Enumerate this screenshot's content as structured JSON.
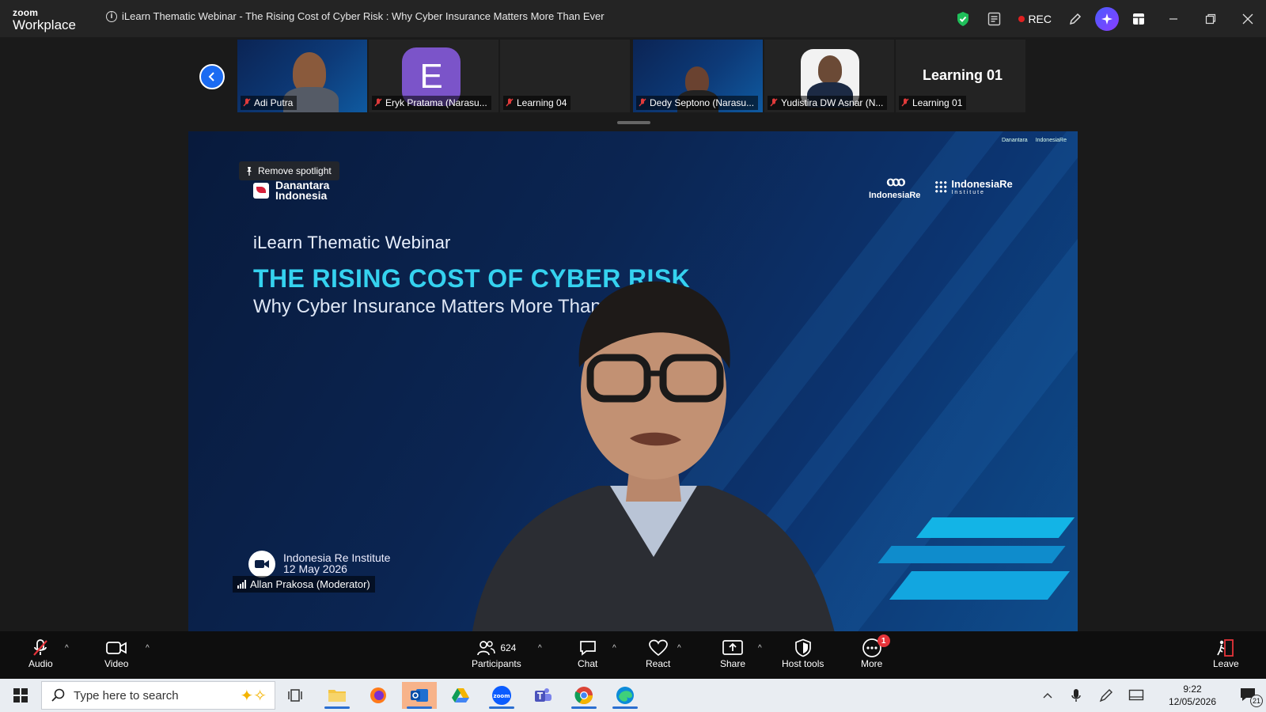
{
  "app": {
    "brand_top": "zoom",
    "brand_bottom": "Workplace"
  },
  "meeting": {
    "title": "iLearn Thematic Webinar - The Rising Cost of Cyber Risk : Why Cyber Insurance Matters More Than Ever"
  },
  "titlebar": {
    "rec_label": "REC"
  },
  "filmstrip": {
    "tiles": [
      {
        "name": "Adi Putra"
      },
      {
        "name": "Eryk Pratama (Narasu...",
        "initial": "E"
      },
      {
        "name": "Learning 04"
      },
      {
        "name": "Dedy Septono (Narasu..."
      },
      {
        "name": "Yudistira DW Asnar (N..."
      },
      {
        "name": "Learning 01"
      }
    ],
    "active_speaker_label": "Learning 01"
  },
  "stage": {
    "spotlight_label": "Remove spotlight",
    "slide": {
      "org_logo_line1": "Danantara",
      "org_logo_line2": "Indonesia",
      "kicker": "iLearn Thematic Webinar",
      "title": "THE RISING COST OF CYBER RISK",
      "subtitle": "Why Cyber Insurance Matters More Than Ever",
      "partner_1": "IndonesiaRe",
      "partner_2": "IndonesiaRe",
      "partner_2_sub": "Institute",
      "footer_org": "Indonesia Re Institute",
      "footer_date": "12 May 2026"
    },
    "speaker_name": "Allan Prakosa (Moderator)"
  },
  "toolbar": {
    "audio": "Audio",
    "video": "Video",
    "participants": "Participants",
    "participants_count": "624",
    "chat": "Chat",
    "react": "React",
    "share": "Share",
    "host_tools": "Host tools",
    "more": "More",
    "more_badge": "1",
    "leave": "Leave"
  },
  "taskbar": {
    "search_placeholder": "Type here to search",
    "time": "9:22",
    "date": "12/05/2026",
    "notification_count": "21"
  },
  "colors": {
    "accent_blue": "#1b6bf2",
    "slide_title": "#35d2ef",
    "rec_red": "#e02020"
  }
}
